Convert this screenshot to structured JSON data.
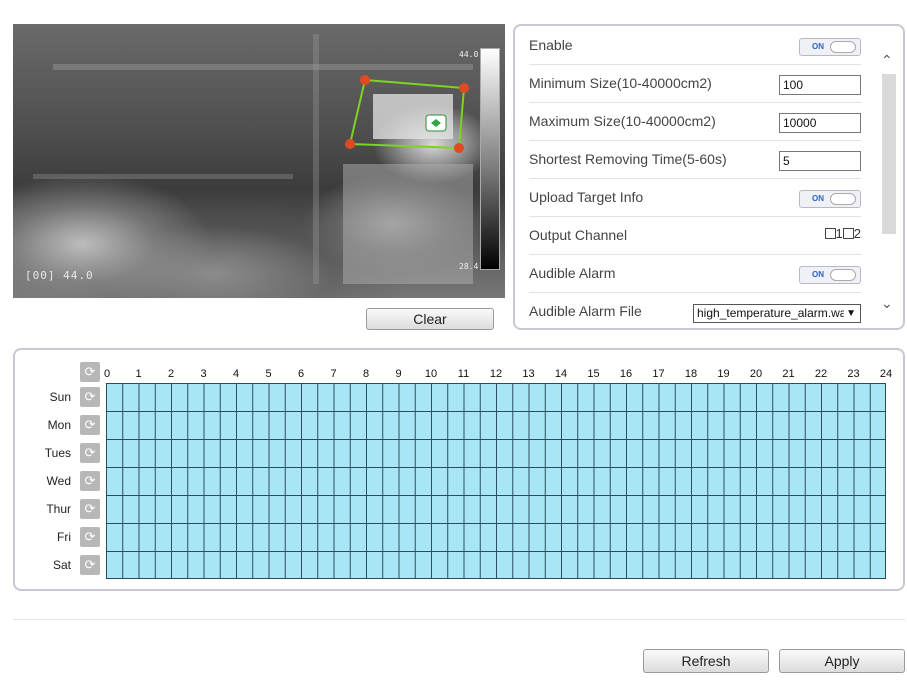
{
  "preview": {
    "osd_temperature": "[00] 44.0",
    "scale_max": "44.0",
    "scale_min": "28.4",
    "clear_label": "Clear"
  },
  "settings": {
    "enable_label": "Enable",
    "enable_state": "ON",
    "min_size_label": "Minimum Size(10-40000cm2)",
    "min_size_value": "100",
    "max_size_label": "Maximum Size(10-40000cm2)",
    "max_size_value": "10000",
    "removing_time_label": "Shortest Removing Time(5-60s)",
    "removing_time_value": "5",
    "upload_label": "Upload Target Info",
    "upload_state": "ON",
    "output_channel_label": "Output Channel",
    "channel_1": "1",
    "channel_2": "2",
    "audible_alarm_label": "Audible Alarm",
    "audible_alarm_state": "ON",
    "alarm_file_label": "Audible Alarm File",
    "alarm_file_value": "high_temperature_alarm.wav"
  },
  "schedule": {
    "hours": [
      "0",
      "1",
      "2",
      "3",
      "4",
      "5",
      "6",
      "7",
      "8",
      "9",
      "10",
      "11",
      "12",
      "13",
      "14",
      "15",
      "16",
      "17",
      "18",
      "19",
      "20",
      "21",
      "22",
      "23",
      "24"
    ],
    "days": [
      "Sun",
      "Mon",
      "Tues",
      "Wed",
      "Thur",
      "Fri",
      "Sat"
    ],
    "fill_color": "#a9e6f5"
  },
  "footer": {
    "refresh_label": "Refresh",
    "apply_label": "Apply"
  },
  "icons": {
    "copy": "copy-schedule-icon",
    "scroll_up": "chevron-up-icon",
    "scroll_down": "chevron-down-icon"
  }
}
